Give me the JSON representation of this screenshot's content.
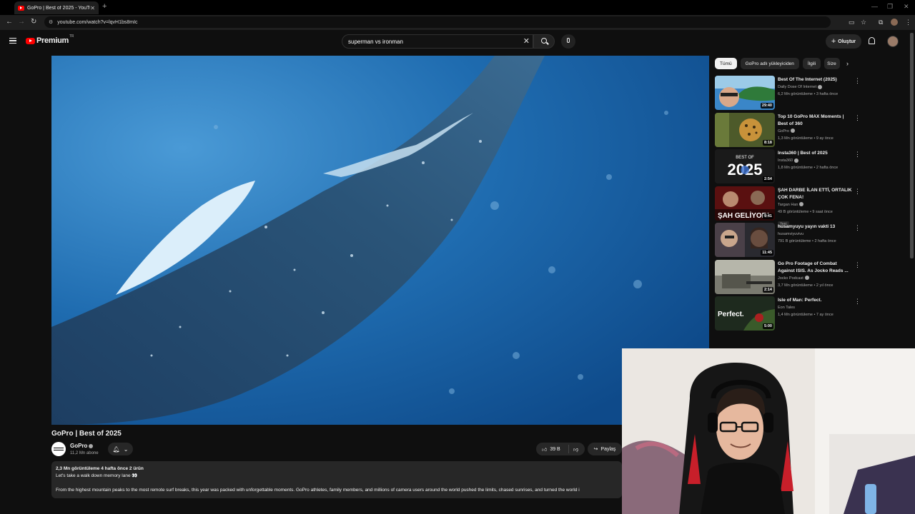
{
  "browser": {
    "tab_title": "GoPro | Best of 2025 - YouTube",
    "url": "youtube.com/watch?v=lqvH1bs8mIc"
  },
  "header": {
    "logo_text": "Premium",
    "logo_sup": "TR",
    "search_value": "superman vs ironman",
    "create_label": "Oluştur"
  },
  "video": {
    "title": "GoPro | Best of 2025",
    "channel": "GoPro",
    "subscribers": "11,2 Mn abone",
    "likes": "39 B",
    "share_label": "Paylaş",
    "stats": "2,3 Mn görüntüleme  4 hafta önce  2 ürün",
    "tagline": "Let's take a walk down memory lane 👀",
    "description": "From the highest mountain peaks to the most remote surf breaks, this year was packed with unforgettable moments. GoPro athletes, family members, and millions of camera users around the world pushed the limits, chased sunrises, and turned the world i"
  },
  "chips": [
    "Tümü",
    "GoPro adlı yükleyiciden",
    "İlgili",
    "Size"
  ],
  "recommendations": [
    {
      "title": "Best Of The Internet (2025)",
      "channel": "Daily Dose Of Internet",
      "verified": true,
      "meta": "6,2 Mn görüntüleme • 3 hafta önce",
      "duration": "29:40",
      "thumb": "thumb-island"
    },
    {
      "title": "Top 10 GoPro MAX Moments | Best of 360",
      "channel": "GoPro",
      "verified": true,
      "meta": "1,3 Mn görüntüleme • 9 ay önce",
      "duration": "8:18",
      "thumb": "thumb-leopard"
    },
    {
      "title": "Insta360 | Best of 2025",
      "channel": "Insta360",
      "verified": true,
      "meta": "1,8 Mn görüntüleme • 2 hafta önce",
      "duration": "2:54",
      "thumb": "thumb-2025"
    },
    {
      "title": "ŞAH DARBE İLAN ETTİ, ORTALIK ÇOK FENA!",
      "channel": "Targan Han",
      "verified": true,
      "meta": "49 B görüntüleme • 9 saat önce",
      "badge": "Yeni",
      "duration": "9:41",
      "thumb": "thumb-sah"
    },
    {
      "title": "husamyuyu yayın vakti 13",
      "channel": "husamviyuvivu",
      "verified": false,
      "meta": "791 B görüntüleme • 2 hafta önce",
      "duration": "11:45",
      "thumb": "thumb-stream"
    },
    {
      "title": "Go Pro Footage of Combat Against ISIS. As Jocko Reads ...",
      "channel": "Jocko Podcast",
      "verified": true,
      "meta": "3,7 Mn görüntüleme • 2 yıl önce",
      "duration": "2:14",
      "thumb": "thumb-combat"
    },
    {
      "title": "Isle of Man: Perfect.",
      "channel": "Eon Tales",
      "verified": false,
      "meta": "1,4 Mn görüntüleme • 7 ay önce",
      "duration": "5:00",
      "thumb": "thumb-perfect"
    }
  ],
  "thumb_text": {
    "best_of": "BEST OF",
    "year": "2025",
    "sah": "ŞAH GELİYOR!",
    "perfect": "Perfect."
  },
  "colors": {
    "background": "#0f0f0f",
    "ocean": "#1f67a3",
    "brand_red": "#ff0000"
  }
}
